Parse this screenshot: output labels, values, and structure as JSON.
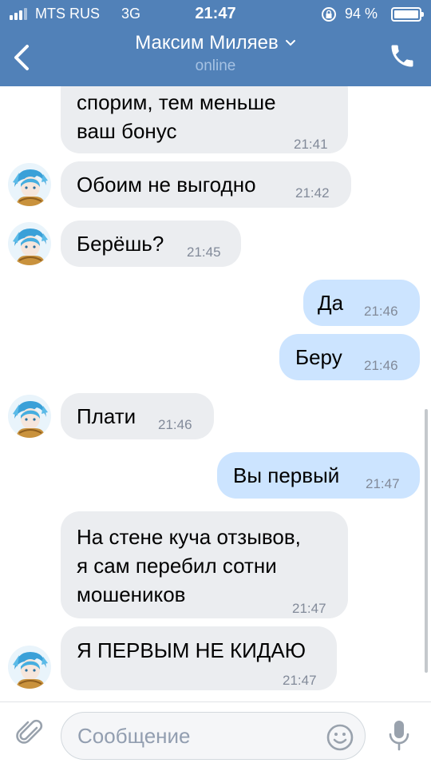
{
  "status_bar": {
    "carrier": "MTS RUS",
    "network": "3G",
    "time": "21:47",
    "battery": "94 %"
  },
  "header": {
    "name": "Максим Миляев",
    "status": "online"
  },
  "messages": [
    {
      "dir": "in",
      "text": "спорим, тем меньше\nваш бонус",
      "time": "21:41"
    },
    {
      "dir": "in",
      "text": "Обоим не выгодно",
      "time": "21:42"
    },
    {
      "dir": "in",
      "text": "Берёшь?",
      "time": "21:45"
    },
    {
      "dir": "out",
      "text": "Да",
      "time": "21:46"
    },
    {
      "dir": "out",
      "text": "Беру",
      "time": "21:46"
    },
    {
      "dir": "in",
      "text": "Плати",
      "time": "21:46"
    },
    {
      "dir": "out",
      "text": "Вы первый",
      "time": "21:47"
    },
    {
      "dir": "in",
      "text": "На стене куча отзывов,\nя сам перебил сотни\nмошеников",
      "time": "21:47"
    },
    {
      "dir": "in",
      "text": "Я ПЕРВЫМ НЕ КИДАЮ",
      "time": "21:47"
    }
  ],
  "composer": {
    "placeholder": "Сообщение"
  },
  "colors": {
    "header_bg": "#5181b8",
    "incoming_bubble": "#ebedf0",
    "outgoing_bubble": "#cce4ff",
    "timestamp": "#828a99"
  }
}
